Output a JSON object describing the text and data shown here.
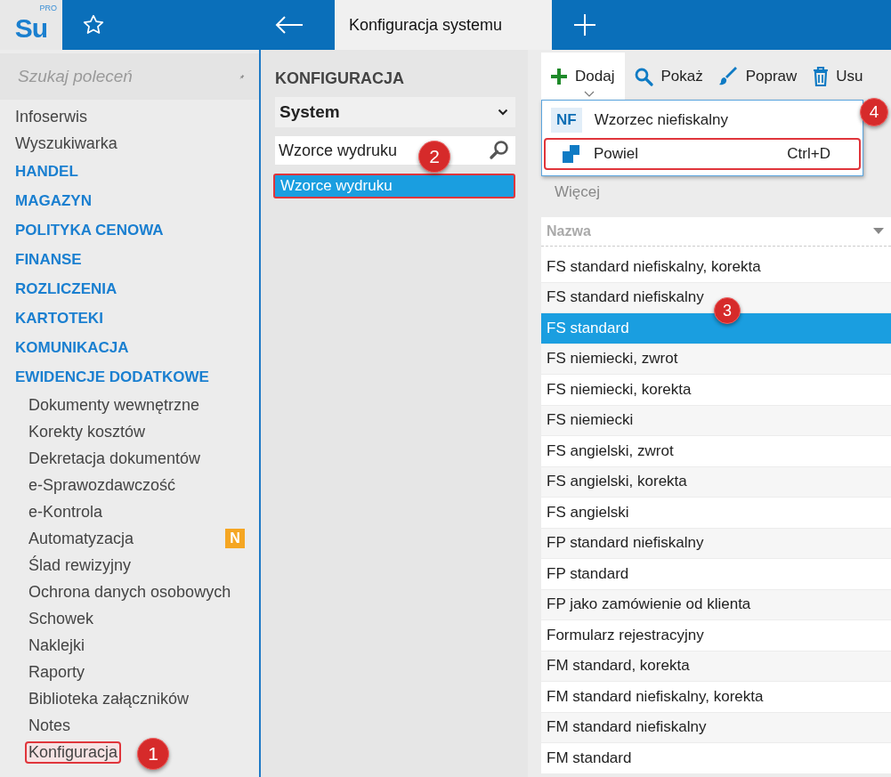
{
  "topbar": {
    "logo": "Su",
    "logo_sup": "PRO",
    "tabs": [
      {
        "label": "Konfiguracja systemu",
        "selected": true
      }
    ]
  },
  "sidebar": {
    "search": {
      "placeholder": "Szukaj poleceń"
    },
    "items": [
      {
        "label": "Infoserwis",
        "kind": "link",
        "outlined": false
      },
      {
        "label": "Wyszukiwarka",
        "kind": "link",
        "outlined": false
      },
      {
        "label": "HANDEL",
        "kind": "section",
        "outlined": false
      },
      {
        "label": "MAGAZYN",
        "kind": "section",
        "outlined": false
      },
      {
        "label": "POLITYKA CENOWA",
        "kind": "section",
        "outlined": false
      },
      {
        "label": "FINANSE",
        "kind": "section",
        "outlined": false
      },
      {
        "label": "ROZLICZENIA",
        "kind": "section",
        "outlined": false
      },
      {
        "label": "KARTOTEKI",
        "kind": "section",
        "outlined": false
      },
      {
        "label": "KOMUNIKACJA",
        "kind": "section",
        "outlined": false
      },
      {
        "label": "EWIDENCJE DODATKOWE",
        "kind": "section",
        "outlined": false
      },
      {
        "label": "Dokumenty wewnętrzne",
        "kind": "sub",
        "outlined": false
      },
      {
        "label": "Korekty kosztów",
        "kind": "sub",
        "outlined": false
      },
      {
        "label": "Dekretacja dokumentów",
        "kind": "sub",
        "outlined": false
      },
      {
        "label": "e-Sprawozdawczość",
        "kind": "sub",
        "outlined": false
      },
      {
        "label": "e-Kontrola",
        "kind": "sub",
        "outlined": false
      },
      {
        "label": "Automatyzacja",
        "kind": "sub",
        "outlined": false,
        "badge": "N"
      },
      {
        "label": "Ślad rewizyjny",
        "kind": "sub",
        "outlined": false
      },
      {
        "label": "Ochrona danych osobowych",
        "kind": "sub",
        "outlined": false
      },
      {
        "label": "Schowek",
        "kind": "sub",
        "outlined": false
      },
      {
        "label": "Naklejki",
        "kind": "sub",
        "outlined": false
      },
      {
        "label": "Raporty",
        "kind": "sub",
        "outlined": false
      },
      {
        "label": "Biblioteka załączników",
        "kind": "sub",
        "outlined": false
      },
      {
        "label": "Notes",
        "kind": "sub",
        "outlined": false
      },
      {
        "label": "Konfiguracja",
        "kind": "sub",
        "outlined": true,
        "callout": "1"
      }
    ]
  },
  "middle": {
    "title": "KONFIGURACJA",
    "dropdown": "System",
    "search": {
      "value": "Wzorce wydruku",
      "callout": "2"
    },
    "tree": [
      {
        "label": "Wzorce wydruku",
        "selected": true,
        "outlined": true
      }
    ]
  },
  "toolbar": [
    {
      "label": "Dodaj",
      "open": true
    },
    {
      "label": "Pokaż",
      "open": false
    },
    {
      "label": "Popraw",
      "open": false
    },
    {
      "label": "Usu",
      "open": false
    }
  ],
  "menu": [
    {
      "label": "Wzorzec niefiskalny",
      "icon_text": "NF",
      "outlined": false,
      "callout": "4"
    },
    {
      "label": "Powiel",
      "shortcut": "Ctrl+D",
      "outlined": true
    }
  ],
  "more": "Więcej",
  "grid": {
    "column": "Nazwa",
    "rows": [
      {
        "name": "FS standard niefiskalny, korekta",
        "selected": false
      },
      {
        "name": "FS standard niefiskalny",
        "selected": false,
        "callout": "3"
      },
      {
        "name": "FS standard",
        "selected": true
      },
      {
        "name": "FS niemiecki, zwrot",
        "selected": false
      },
      {
        "name": "FS niemiecki, korekta",
        "selected": false
      },
      {
        "name": "FS niemiecki",
        "selected": false
      },
      {
        "name": "FS angielski, zwrot",
        "selected": false
      },
      {
        "name": "FS angielski, korekta",
        "selected": false
      },
      {
        "name": "FS angielski",
        "selected": false
      },
      {
        "name": "FP standard niefiskalny",
        "selected": false
      },
      {
        "name": "FP standard",
        "selected": false
      },
      {
        "name": "FP jako zamówienie od klienta",
        "selected": false
      },
      {
        "name": "Formularz rejestracyjny",
        "selected": false
      },
      {
        "name": "FM standard, korekta",
        "selected": false
      },
      {
        "name": "FM standard niefiskalny, korekta",
        "selected": false
      },
      {
        "name": "FM standard niefiskalny",
        "selected": false
      },
      {
        "name": "FM standard",
        "selected": false
      }
    ]
  }
}
